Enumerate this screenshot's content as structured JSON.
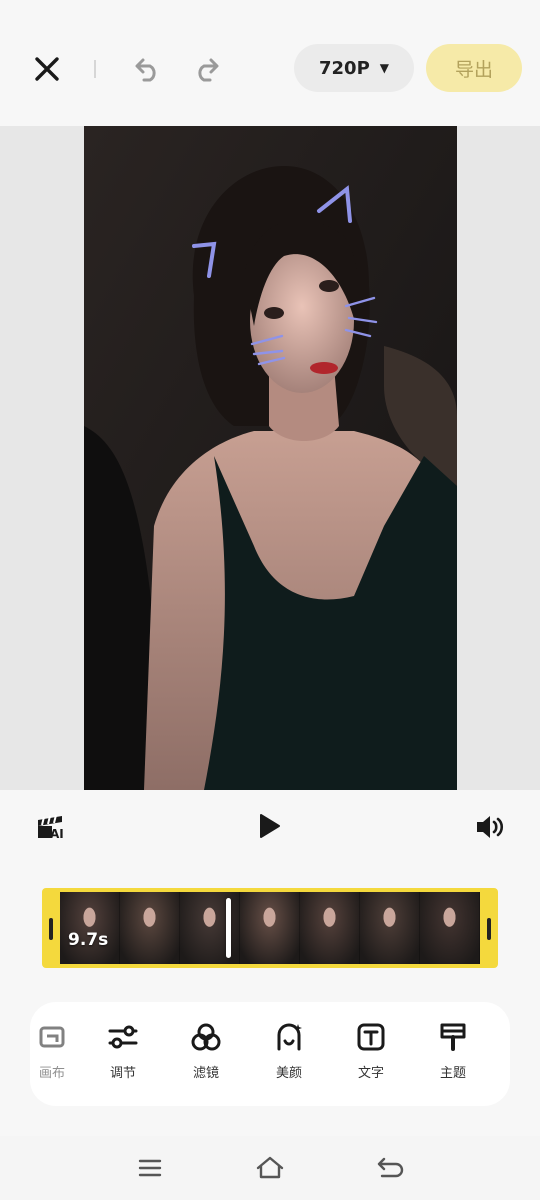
{
  "header": {
    "resolution": "720P",
    "export_label": "导出"
  },
  "timeline": {
    "duration": "9.7s",
    "thumbnail_count": 7
  },
  "tools": [
    {
      "label": "画布",
      "icon": "canvas-icon"
    },
    {
      "label": "调节",
      "icon": "adjust-icon"
    },
    {
      "label": "滤镜",
      "icon": "filter-icon"
    },
    {
      "label": "美颜",
      "icon": "beauty-icon"
    },
    {
      "label": "文字",
      "icon": "text-icon"
    },
    {
      "label": "主题",
      "icon": "theme-icon"
    }
  ],
  "icons": {
    "close": "close-icon",
    "undo": "undo-icon",
    "redo": "redo-icon",
    "ai": "ai-clip-icon",
    "play": "play-icon",
    "volume": "volume-icon",
    "nav_menu": "menu-icon",
    "nav_home": "home-icon",
    "nav_back": "back-icon"
  },
  "colors": {
    "accent": "#f4d93d",
    "export_bg": "#f6eaa8",
    "export_text": "#b3a25c"
  }
}
